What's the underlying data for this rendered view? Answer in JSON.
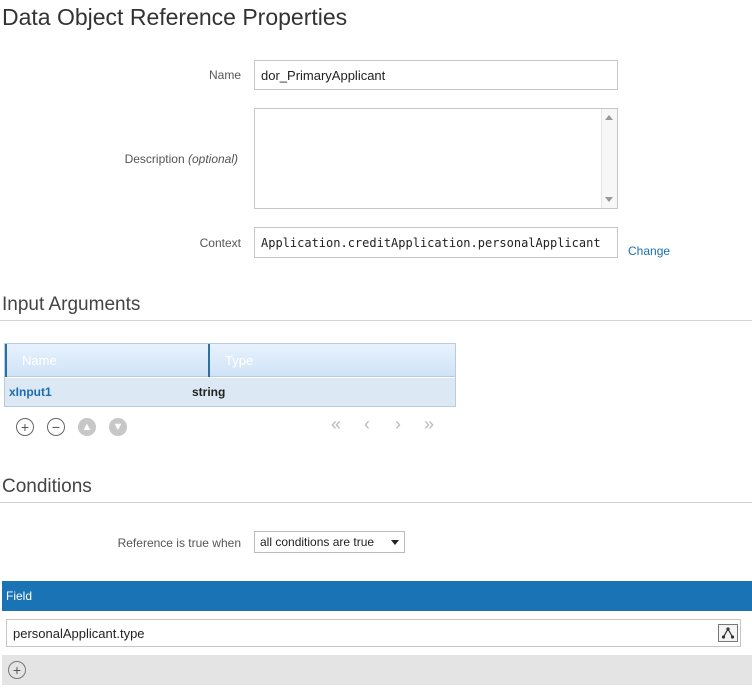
{
  "page_title": "Data Object Reference Properties",
  "form": {
    "name_label": "Name",
    "name_value": "dor_PrimaryApplicant",
    "description_label": "Description",
    "description_optional": "(optional)",
    "description_value": "",
    "context_label": "Context",
    "context_value": "Application.creditApplication.personalApplicant",
    "change_link": "Change"
  },
  "input_arguments": {
    "title": "Input Arguments",
    "columns": [
      "Name",
      "Type"
    ],
    "rows": [
      {
        "name": "xInput1",
        "type": "string"
      }
    ]
  },
  "conditions": {
    "title": "Conditions",
    "reference_label": "Reference is true when",
    "reference_selected": "all conditions are true",
    "field_header": "Field",
    "field_value": "personalApplicant.type"
  },
  "colors": {
    "accent": "#1a73b5",
    "link": "#1a6eb0",
    "grid_row": "#dce8f3"
  }
}
